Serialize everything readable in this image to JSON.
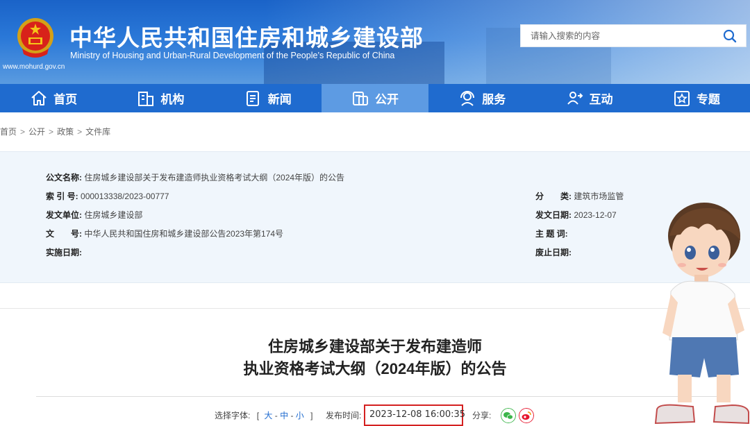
{
  "header": {
    "site_title": "中华人民共和国住房和城乡建设部",
    "site_subtitle": "Ministry of Housing and Urban-Rural Development of the People’s Republic of China",
    "site_url": "www.mohurd.gov.cn",
    "search_placeholder": "请输入搜索的内容"
  },
  "nav": {
    "items": [
      {
        "label": "首页",
        "icon": "home-icon"
      },
      {
        "label": "机构",
        "icon": "building-icon"
      },
      {
        "label": "新闻",
        "icon": "news-icon"
      },
      {
        "label": "公开",
        "icon": "disclosure-icon",
        "active": true
      },
      {
        "label": "服务",
        "icon": "service-icon"
      },
      {
        "label": "互动",
        "icon": "interaction-icon"
      },
      {
        "label": "专题",
        "icon": "star-icon"
      }
    ],
    "bg_color": "#1f6bcf",
    "active_color": "#5d9be3"
  },
  "breadcrumb": [
    "首页",
    "公开",
    "政策",
    "文件库"
  ],
  "info": {
    "title_label": "公文名称:",
    "title_value": "住房城乡建设部关于发布建造师执业资格考试大纲（2024年版）的公告",
    "index_label": "索 引 号:",
    "index_value": "000013338/2023-00777",
    "issuer_label": "发文单位:",
    "issuer_value": "住房城乡建设部",
    "docno_label": "文　　号:",
    "docno_value": "中华人民共和国住房和城乡建设部公告2023年第174号",
    "effective_label": "实施日期:",
    "effective_value": "",
    "category_label": "分　　类:",
    "category_value": "建筑市场监管",
    "issue_date_label": "发文日期:",
    "issue_date_value": "2023-12-07",
    "keywords_label": "主 题 词:",
    "keywords_value": "",
    "repeal_label": "废止日期:",
    "repeal_value": ""
  },
  "document": {
    "title_line1": "住房城乡建设部关于发布建造师",
    "title_line2": "执业资格考试大纲（2024年版）的公告"
  },
  "meta": {
    "font_label": "选择字体:",
    "bracket_open": "[",
    "font_large": "大",
    "dash1": "-",
    "font_medium": "中",
    "dash2": "-",
    "font_small": "小",
    "bracket_close": "]",
    "publish_label": "发布时间:",
    "publish_time": "2023-12-08 16:00:35",
    "share_label": "分享:",
    "highlight_color": "#d42020"
  }
}
